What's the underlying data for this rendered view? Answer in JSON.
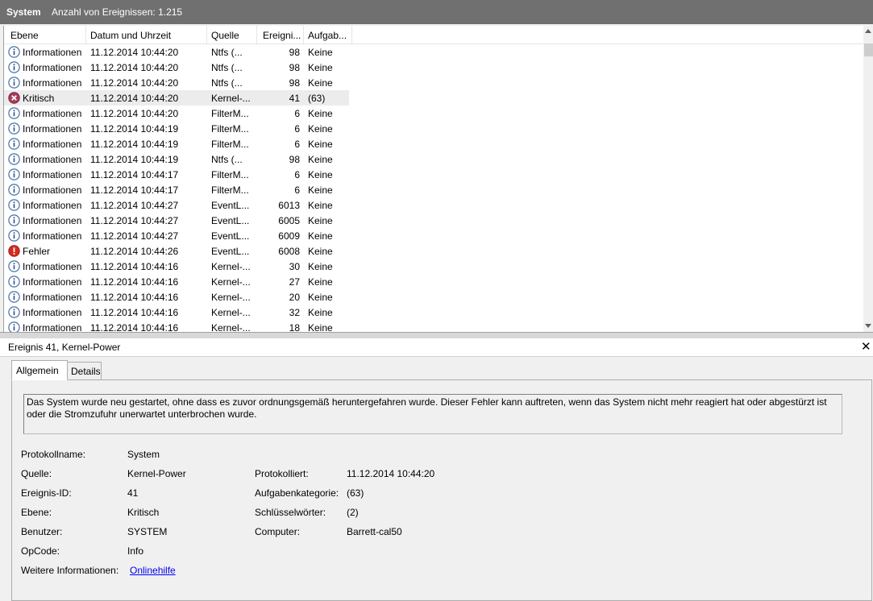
{
  "titlebar": {
    "log_name": "System",
    "event_count": "Anzahl von Ereignissen: 1.215"
  },
  "columns": [
    "Ebene",
    "Datum und Uhrzeit",
    "Quelle",
    "Ereigni...",
    "Aufgab..."
  ],
  "events": [
    {
      "icon": "info-icon",
      "level": "Informationen",
      "date": "11.12.2014 10:44:20",
      "source": "Ntfs (...",
      "id": "98",
      "task": "Keine"
    },
    {
      "icon": "info-icon",
      "level": "Informationen",
      "date": "11.12.2014 10:44:20",
      "source": "Ntfs (...",
      "id": "98",
      "task": "Keine"
    },
    {
      "icon": "info-icon",
      "level": "Informationen",
      "date": "11.12.2014 10:44:20",
      "source": "Ntfs (...",
      "id": "98",
      "task": "Keine"
    },
    {
      "icon": "critical-icon",
      "level": "Kritisch",
      "date": "11.12.2014 10:44:20",
      "source": "Kernel-...",
      "id": "41",
      "task": "(63)",
      "selected": true
    },
    {
      "icon": "info-icon",
      "level": "Informationen",
      "date": "11.12.2014 10:44:20",
      "source": "FilterM...",
      "id": "6",
      "task": "Keine"
    },
    {
      "icon": "info-icon",
      "level": "Informationen",
      "date": "11.12.2014 10:44:19",
      "source": "FilterM...",
      "id": "6",
      "task": "Keine"
    },
    {
      "icon": "info-icon",
      "level": "Informationen",
      "date": "11.12.2014 10:44:19",
      "source": "FilterM...",
      "id": "6",
      "task": "Keine"
    },
    {
      "icon": "info-icon",
      "level": "Informationen",
      "date": "11.12.2014 10:44:19",
      "source": "Ntfs (...",
      "id": "98",
      "task": "Keine"
    },
    {
      "icon": "info-icon",
      "level": "Informationen",
      "date": "11.12.2014 10:44:17",
      "source": "FilterM...",
      "id": "6",
      "task": "Keine"
    },
    {
      "icon": "info-icon",
      "level": "Informationen",
      "date": "11.12.2014 10:44:17",
      "source": "FilterM...",
      "id": "6",
      "task": "Keine"
    },
    {
      "icon": "info-icon",
      "level": "Informationen",
      "date": "11.12.2014 10:44:27",
      "source": "EventL...",
      "id": "6013",
      "task": "Keine"
    },
    {
      "icon": "info-icon",
      "level": "Informationen",
      "date": "11.12.2014 10:44:27",
      "source": "EventL...",
      "id": "6005",
      "task": "Keine"
    },
    {
      "icon": "info-icon",
      "level": "Informationen",
      "date": "11.12.2014 10:44:27",
      "source": "EventL...",
      "id": "6009",
      "task": "Keine"
    },
    {
      "icon": "error-icon",
      "level": "Fehler",
      "date": "11.12.2014 10:44:26",
      "source": "EventL...",
      "id": "6008",
      "task": "Keine"
    },
    {
      "icon": "info-icon",
      "level": "Informationen",
      "date": "11.12.2014 10:44:16",
      "source": "Kernel-...",
      "id": "30",
      "task": "Keine"
    },
    {
      "icon": "info-icon",
      "level": "Informationen",
      "date": "11.12.2014 10:44:16",
      "source": "Kernel-...",
      "id": "27",
      "task": "Keine"
    },
    {
      "icon": "info-icon",
      "level": "Informationen",
      "date": "11.12.2014 10:44:16",
      "source": "Kernel-...",
      "id": "20",
      "task": "Keine"
    },
    {
      "icon": "info-icon",
      "level": "Informationen",
      "date": "11.12.2014 10:44:16",
      "source": "Kernel-...",
      "id": "32",
      "task": "Keine"
    },
    {
      "icon": "info-icon",
      "level": "Informationen",
      "date": "11.12.2014 10:44:16",
      "source": "Kernel-...",
      "id": "18",
      "task": "Keine"
    }
  ],
  "detail": {
    "title": "Ereignis 41, Kernel-Power",
    "tabs": {
      "general": "Allgemein",
      "details": "Details"
    },
    "description": "Das System wurde neu gestartet, ohne dass es zuvor ordnungsgemäß heruntergefahren wurde. Dieser Fehler kann auftreten, wenn das System nicht mehr reagiert hat oder abgestürzt ist oder die Stromzufuhr unerwartet unterbrochen wurde.",
    "labels": {
      "log_name": "Protokollname:",
      "source": "Quelle:",
      "event_id": "Ereignis-ID:",
      "level": "Ebene:",
      "user": "Benutzer:",
      "opcode": "OpCode:",
      "more_info": "Weitere Informationen:",
      "logged": "Protokolliert:",
      "task_category": "Aufgabenkategorie:",
      "keywords": "Schlüsselwörter:",
      "computer": "Computer:"
    },
    "values": {
      "log_name": "System",
      "source": "Kernel-Power",
      "event_id": "41",
      "level": "Kritisch",
      "user": "SYSTEM",
      "opcode": "Info",
      "more_info_link": "Onlinehilfe",
      "logged": "11.12.2014 10:44:20",
      "task_category": "(63)",
      "keywords": "(2)",
      "computer": "Barrett-cal50"
    }
  }
}
